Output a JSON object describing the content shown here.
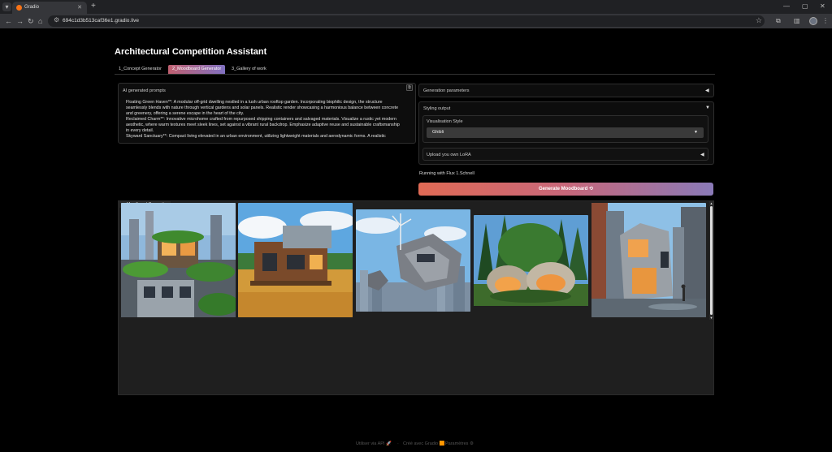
{
  "browser": {
    "tab_title": "Gradio",
    "url": "694c1d3b513caf36e1.gradio.live",
    "colors": {
      "tabstrip": "#202124",
      "toolbar": "#35363a"
    }
  },
  "app": {
    "title": "Architectural Competition Assistant",
    "tabs": [
      {
        "label": "1_Concept Generator",
        "active": false
      },
      {
        "label": "2_Moodboard Generator",
        "active": true
      },
      {
        "label": "3_Gallery of work",
        "active": false
      }
    ]
  },
  "prompts": {
    "label": "AI generated prompts",
    "text": "Floating Green Haven**: A modular off-grid dwelling nestled in a lush urban rooftop garden. Incorporating biophilic design, the structure seamlessly blends with nature through vertical gardens and solar panels. Realistic render showcasing a harmonious balance between concrete and greenery, offering a serene escape in the heart of the city.\nReclaimed Charm**: Innovative microhome crafted from repurposed shipping containers and salvaged materials. Visualize a rustic yet modern aesthetic, where warm textures meet sleek lines, set against a vibrant rural backdrop. Emphasize adaptive reuse and sustainable craftsmanship in every detail.\nSkyward Sanctuary**: Compact living elevated in an urban environment, utilizing lightweight materials and aerodynamic forms. A realistic"
  },
  "params": {
    "generation_label": "Generation parameters",
    "styling_label": "Styling output",
    "visual_style_label": "Visualisation Style",
    "visual_style_value": "Ghibli",
    "lora_label": "Upload you own LoRA"
  },
  "running_text": "Running with Flux 1.Schnell",
  "generate_button": "Generate Moodboard",
  "gallery": {
    "label": "Moodboard Generation",
    "images": [
      "rooftop-garden-house",
      "container-cabin",
      "floating-sky-pod",
      "forest-dome-homes",
      "urban-corner-building"
    ]
  },
  "footer": {
    "api": "Utiliser via API",
    "built": "Créé avec Gradio",
    "settings": "Paramètres"
  },
  "colors": {
    "accent_gradient_start": "#e06a55",
    "accent_gradient_end": "#8a7ab8",
    "background": "#000000",
    "panel": "#0d0d0d"
  }
}
